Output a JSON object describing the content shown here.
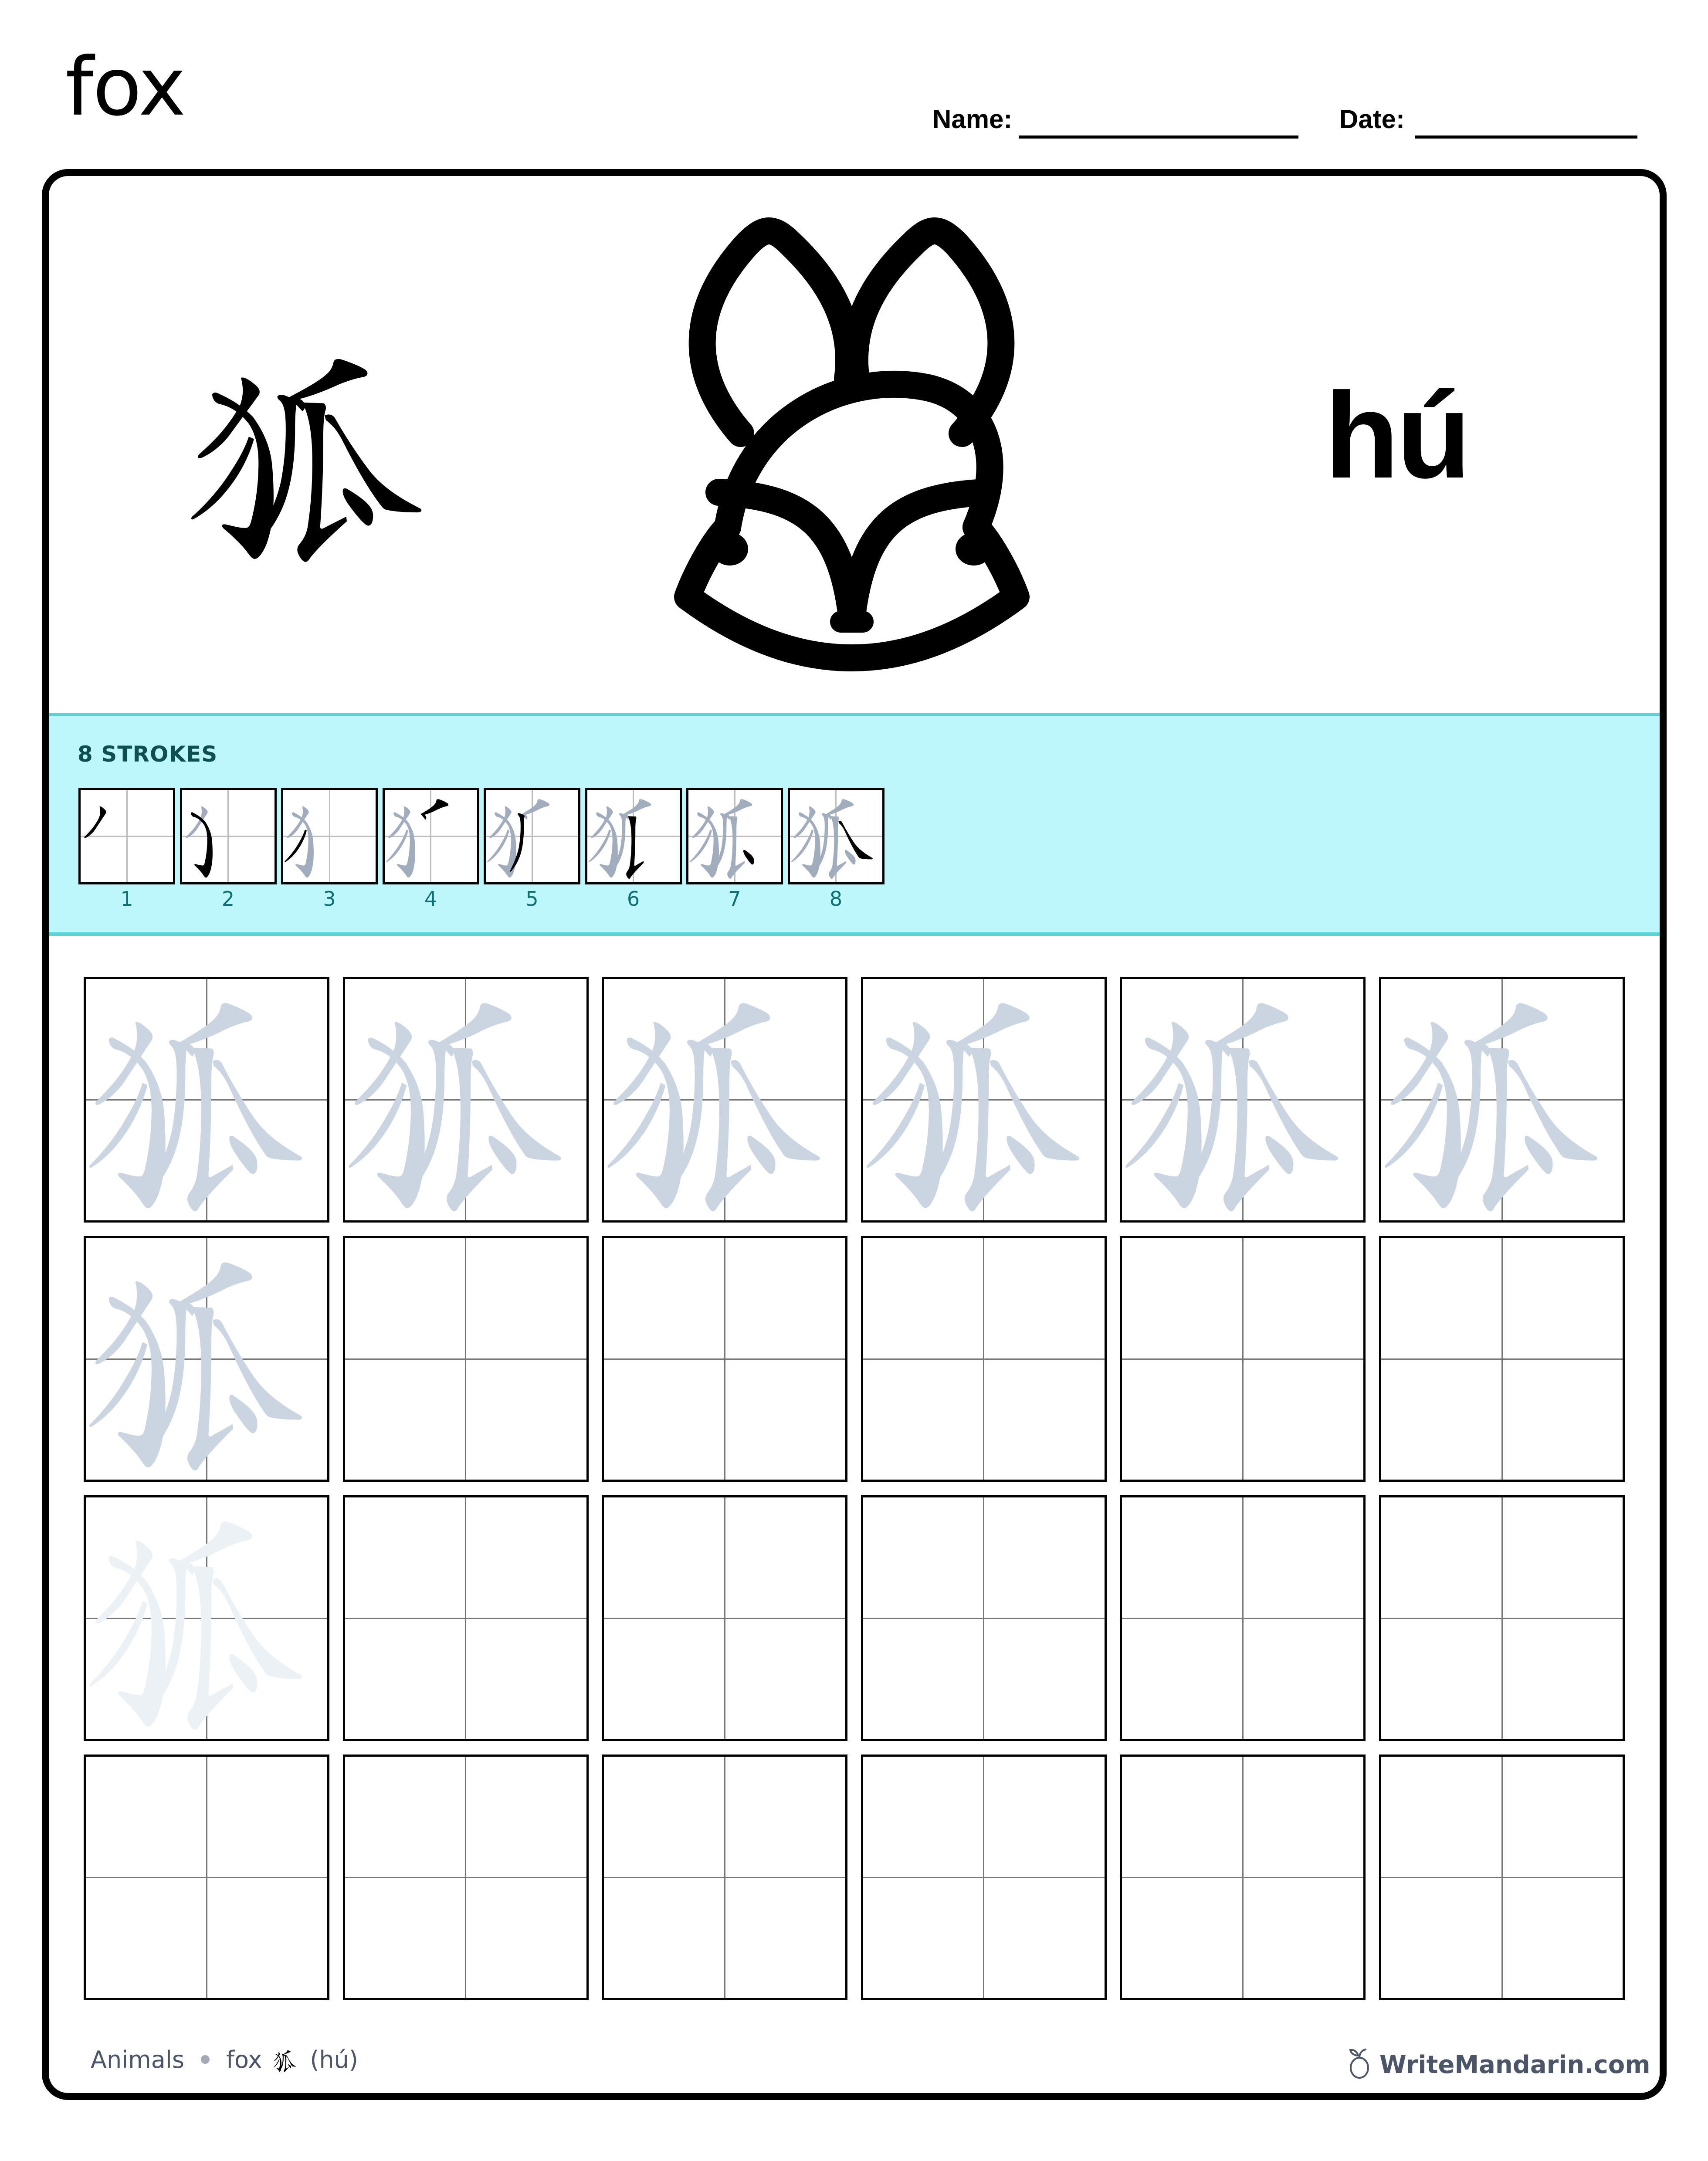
{
  "header": {
    "title": "fox",
    "name_label": "Name:",
    "date_label": "Date:"
  },
  "hero": {
    "character": "狐",
    "pinyin": "hú",
    "image_icon": "fox-face-icon"
  },
  "strokes": {
    "count_label": "8 STROKES",
    "total": 8,
    "steps": [
      "1",
      "2",
      "3",
      "4",
      "5",
      "6",
      "7",
      "8"
    ]
  },
  "practice": {
    "rows": 4,
    "columns": 6,
    "trace_cells": [
      {
        "row": 1,
        "col": 1,
        "shade": "trace"
      },
      {
        "row": 1,
        "col": 2,
        "shade": "trace"
      },
      {
        "row": 1,
        "col": 3,
        "shade": "trace"
      },
      {
        "row": 1,
        "col": 4,
        "shade": "trace"
      },
      {
        "row": 1,
        "col": 5,
        "shade": "trace"
      },
      {
        "row": 1,
        "col": 6,
        "shade": "trace"
      },
      {
        "row": 2,
        "col": 1,
        "shade": "trace"
      },
      {
        "row": 3,
        "col": 1,
        "shade": "faint"
      }
    ]
  },
  "footer": {
    "category": "Animals",
    "word": "fox",
    "character": "狐",
    "pinyin": "(hú)",
    "brand": "WriteMandarin.com",
    "brand_icon": "plum-icon"
  },
  "colors": {
    "ink": "#000000",
    "trace": "#cbd5e1",
    "faint": "#ecf1f6",
    "prior_stroke": "#a1adbd",
    "panel_bg": "#bef7fb",
    "panel_line": "#5ad4dc",
    "panel_text": "#0e4f54",
    "step_number": "#0e6f74",
    "footer_text": "#4b5567"
  }
}
